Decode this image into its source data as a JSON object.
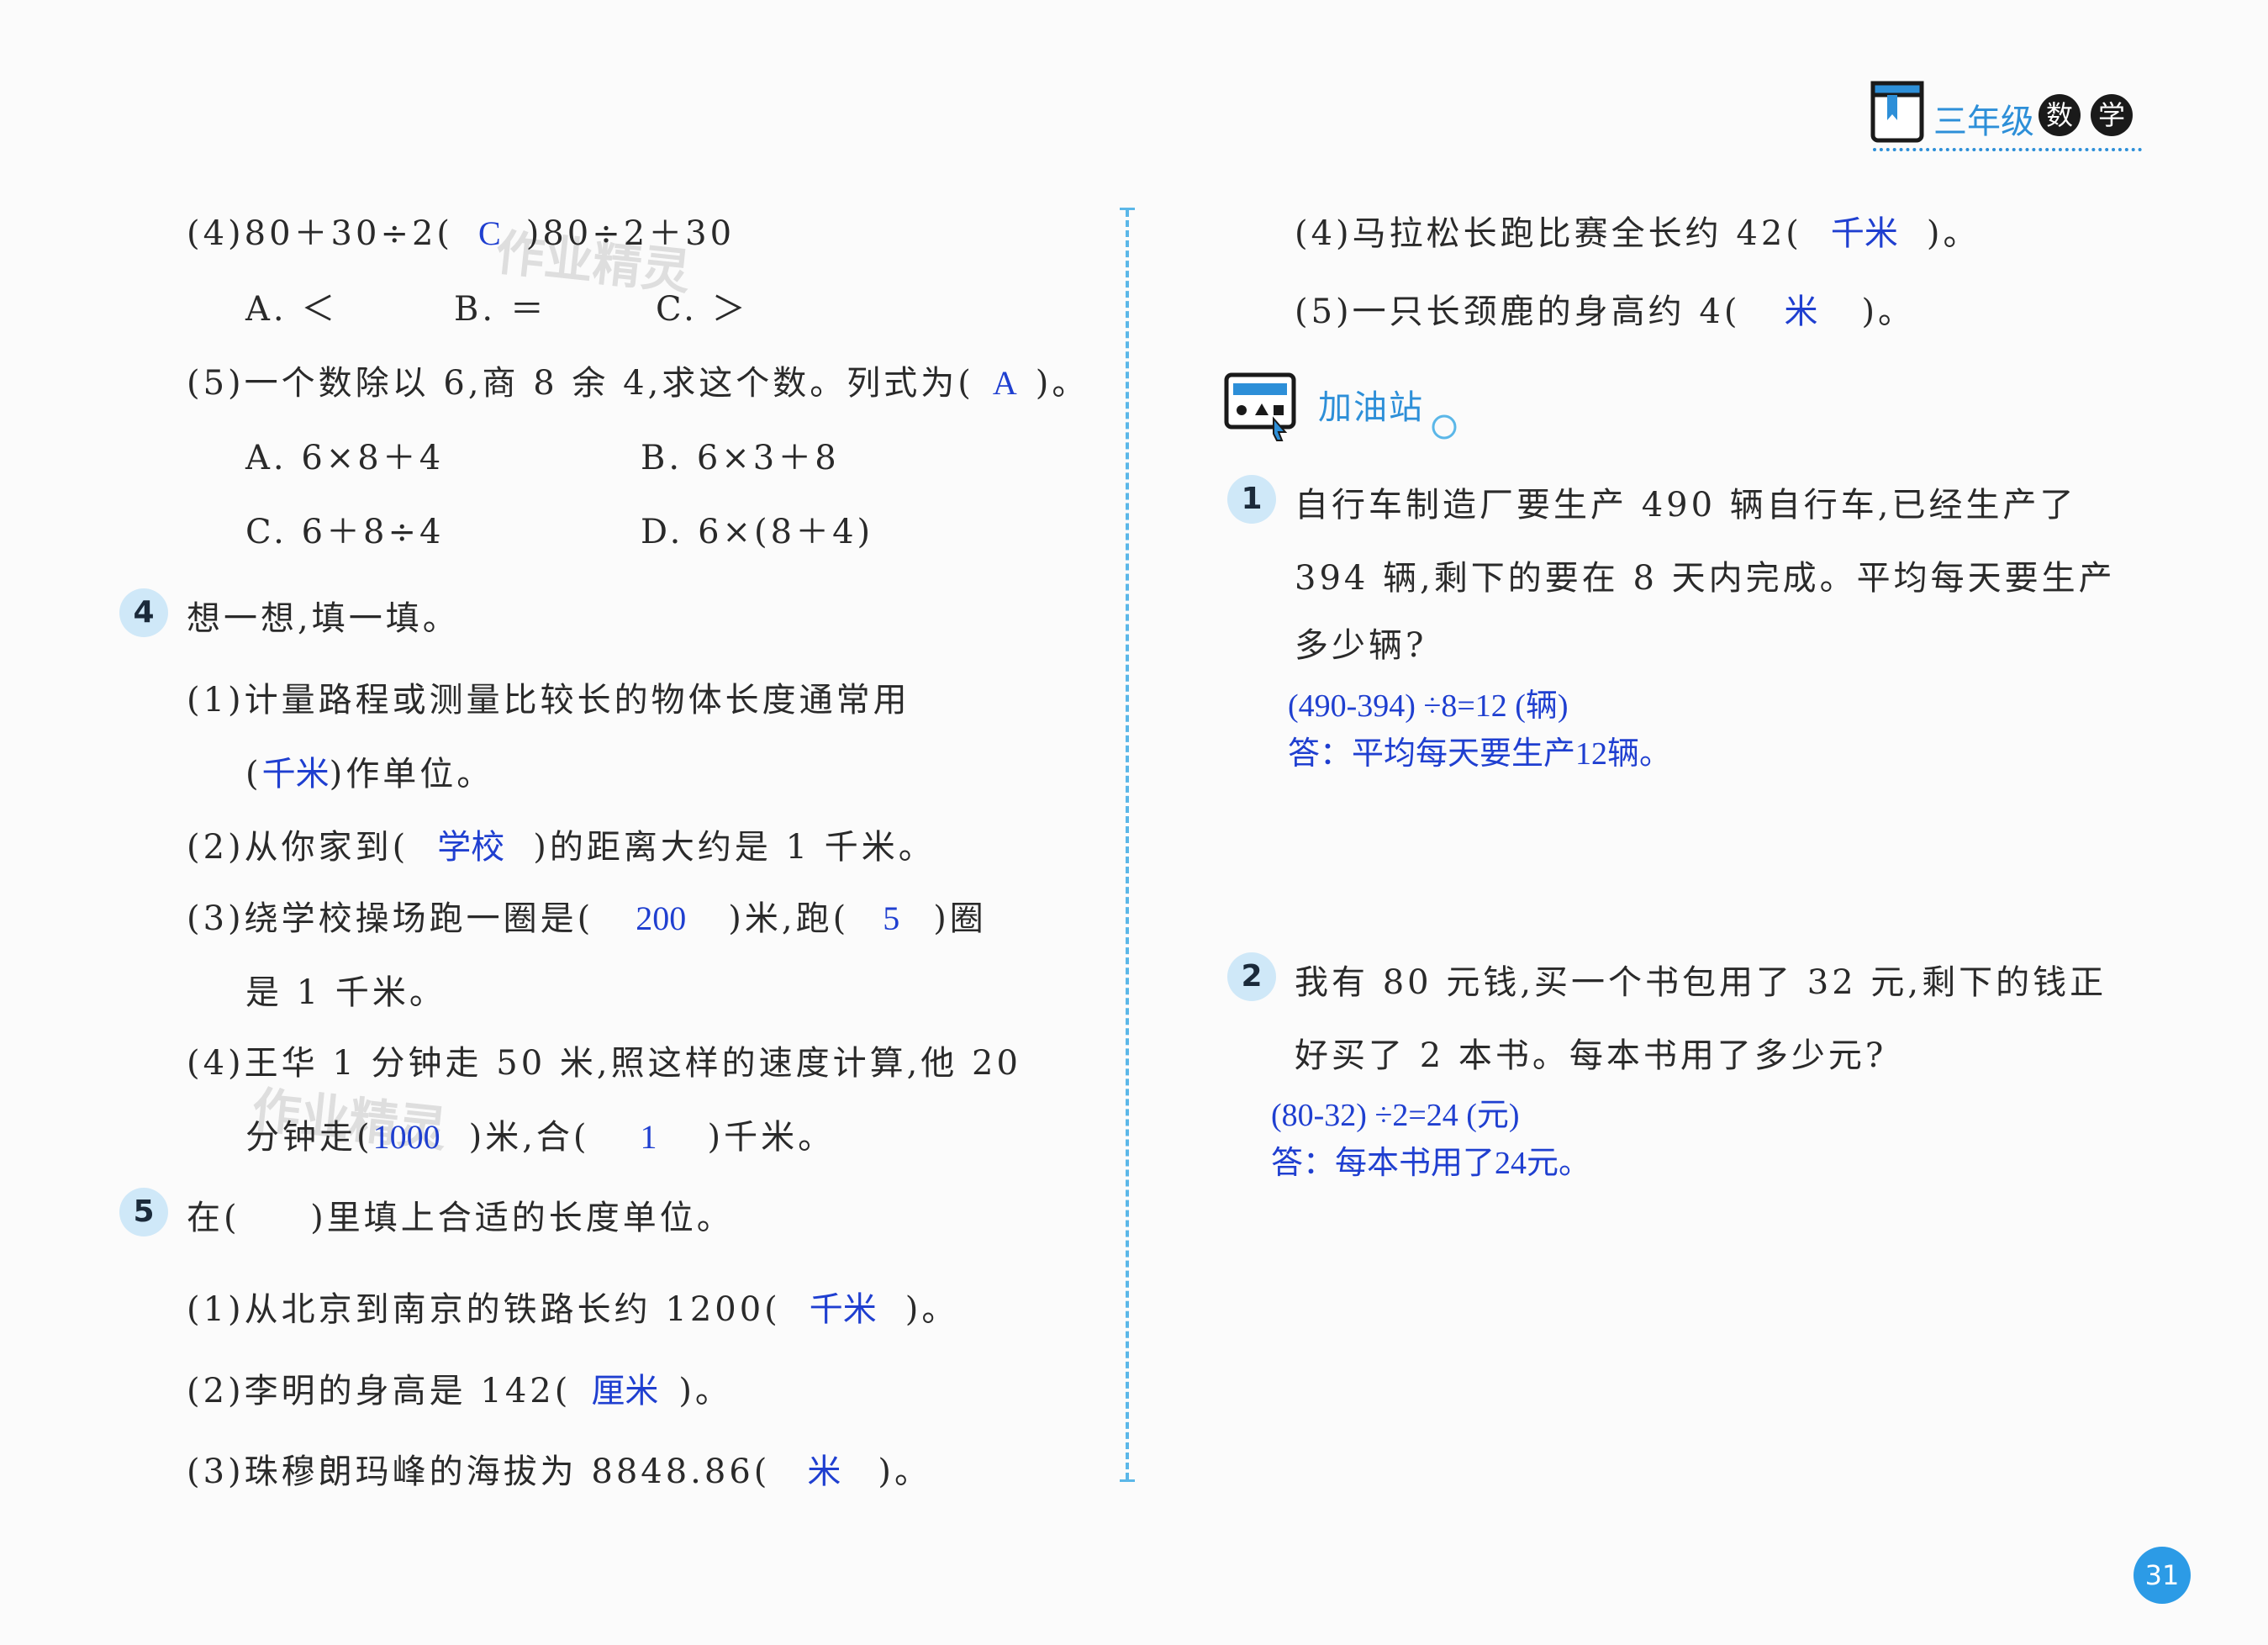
{
  "header": {
    "title": "三年级",
    "c1": "数",
    "c2": "学"
  },
  "page_number": "31",
  "watermark": "作业精灵",
  "left": {
    "q4_4": {
      "pre": "(4)80＋30÷2(",
      "ans": "C",
      "post": ")80÷2＋30"
    },
    "q4_4_opts": {
      "a": "A. ＜",
      "b": "B. ＝",
      "c": "C. ＞"
    },
    "q5_5": {
      "pre": "(5)一个数除以 6,商 8 余 4,求这个数。列式为(",
      "ans": "A",
      "post": ")。"
    },
    "q5_5_opts": {
      "a": "A. 6×8＋4",
      "b": "B. 6×3＋8",
      "c": "C. 6＋8÷4",
      "d": "D. 6×(8＋4)"
    },
    "s4": {
      "num": "4",
      "title": "想一想,填一填。"
    },
    "s4_1": {
      "line1": "(1)计量路程或测量比较长的物体长度通常用",
      "pre2": "(",
      "ans": "千米",
      "post2": ")作单位。"
    },
    "s4_2": {
      "pre": "(2)从你家到(",
      "ans": "学校",
      "post": ")的距离大约是 1 千米。"
    },
    "s4_3": {
      "pre": "(3)绕学校操场跑一圈是(",
      "ans1": "200",
      "mid": ")米,跑(",
      "ans2": "5",
      "post": ")圈",
      "line2": "是 1 千米。"
    },
    "s4_4": {
      "line1": "(4)王华 1 分钟走 50 米,照这样的速度计算,他 20",
      "pre2": "分钟走(",
      "ans1": "1000",
      "mid": ")米,合(",
      "ans2": "1",
      "post": ")千米。"
    },
    "s5": {
      "num": "5",
      "title": "在(     )里填上合适的长度单位。"
    },
    "s5_1": {
      "pre": "(1)从北京到南京的铁路长约 1200(",
      "ans": "千米",
      "post": ")。"
    },
    "s5_2": {
      "pre": "(2)李明的身高是 142(",
      "ans": "厘米",
      "post": ")。"
    },
    "s5_3": {
      "pre": "(3)珠穆朗玛峰的海拔为 8848.86(",
      "ans": "米",
      "post": ")。"
    }
  },
  "right": {
    "s5_4": {
      "pre": "(4)马拉松长跑比赛全长约 42(",
      "ans": "千米",
      "post": ")。"
    },
    "s5_5": {
      "pre": "(5)一只长颈鹿的身高约 4(",
      "ans": "米",
      "post": ")。"
    },
    "section": "加油站",
    "p1": {
      "num": "1",
      "line1": "自行车制造厂要生产 490 辆自行车,已经生产了",
      "line2": "394 辆,剩下的要在 8 天内完成。平均每天要生产",
      "line3": "多少辆?",
      "sol1": "(490-394) ÷8=12 (辆)",
      "sol2": "答：平均每天要生产12辆。"
    },
    "p2": {
      "num": "2",
      "line1": "我有 80 元钱,买一个书包用了 32 元,剩下的钱正",
      "line2": "好买了 2 本书。每本书用了多少元?",
      "sol1": "(80-32) ÷2=24 (元)",
      "sol2": "答：每本书用了24元。"
    }
  }
}
